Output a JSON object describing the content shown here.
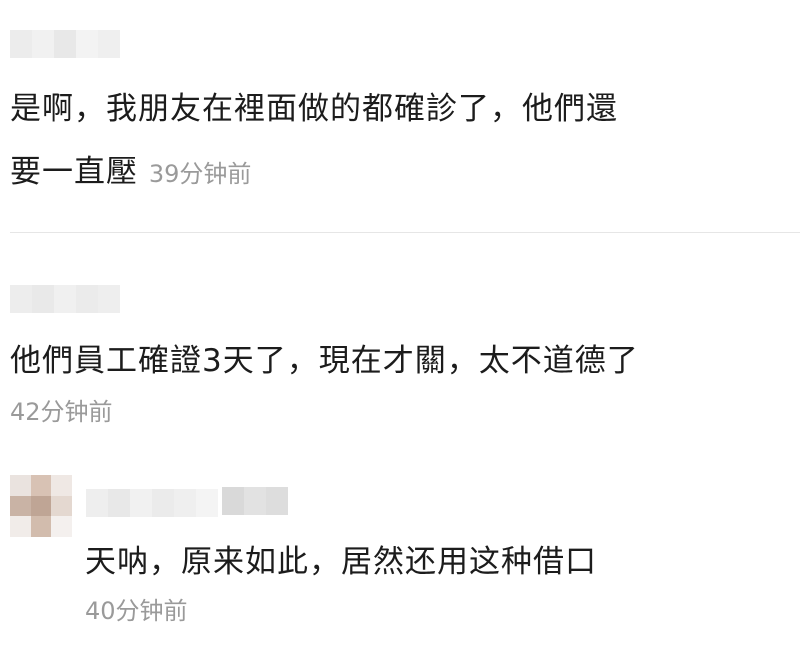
{
  "comments": [
    {
      "text_line1": "是啊，我朋友在裡面做的都確診了，他們還",
      "text_line2": "要一直壓",
      "time": "39分钟前"
    },
    {
      "text_line1": "他們員工確證3天了，現在才關，太不道德了",
      "time": "42分钟前"
    },
    {
      "text_line1": "天呐，原来如此，居然还用这种借口",
      "time": "40分钟前"
    }
  ]
}
